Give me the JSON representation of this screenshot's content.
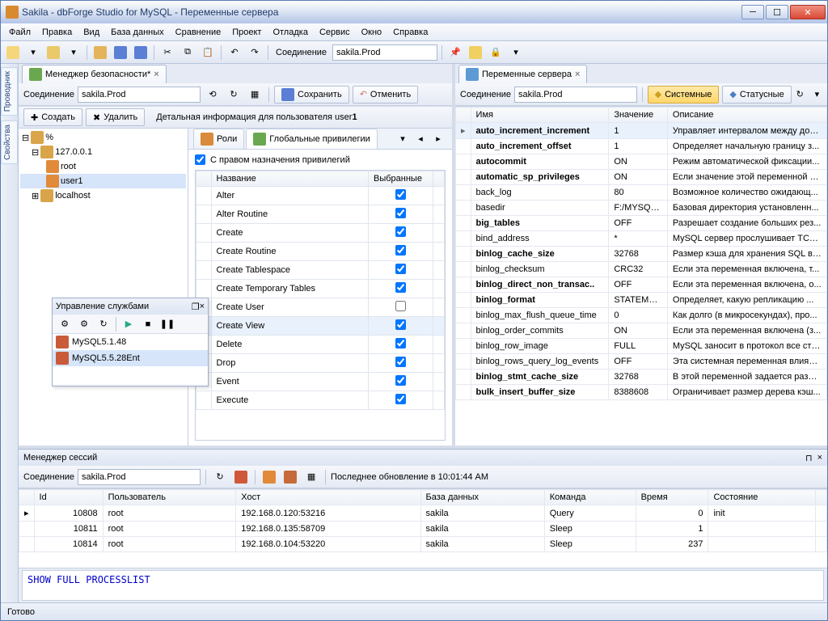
{
  "title": "Sakila - dbForge Studio for MySQL - Переменные сервера",
  "menu": [
    "Файл",
    "Правка",
    "Вид",
    "База данных",
    "Сравнение",
    "Проект",
    "Отладка",
    "Сервис",
    "Окно",
    "Справка"
  ],
  "toolbar": {
    "conn_label": "Соединение",
    "conn_value": "sakila.Prod"
  },
  "side_tabs": [
    "Проводник",
    "Свойства"
  ],
  "sec": {
    "tab": "Менеджер безопасности*",
    "conn_label": "Соединение",
    "conn_value": "sakila.Prod",
    "save": "Сохранить",
    "cancel": "Отменить",
    "create": "Создать",
    "delete": "Удалить",
    "detail_title": "Детальная информация для пользователя user",
    "tabs": {
      "roles": "Роли",
      "global": "Глобальные привилегии"
    },
    "grant_check": "С правом назначения привилегий",
    "cols": {
      "name": "Название",
      "selected": "Выбранные"
    },
    "tree": [
      "%",
      "127.0.0.1",
      "root",
      "user1",
      "localhost"
    ],
    "privs": [
      {
        "n": "Alter",
        "c": true
      },
      {
        "n": "Alter Routine",
        "c": true
      },
      {
        "n": "Create",
        "c": true
      },
      {
        "n": "Create Routine",
        "c": true
      },
      {
        "n": "Create Tablespace",
        "c": true
      },
      {
        "n": "Create Temporary Tables",
        "c": true
      },
      {
        "n": "Create User",
        "c": false
      },
      {
        "n": "Create View",
        "c": true,
        "sel": true
      },
      {
        "n": "Delete",
        "c": true
      },
      {
        "n": "Drop",
        "c": true
      },
      {
        "n": "Event",
        "c": true
      },
      {
        "n": "Execute",
        "c": true
      }
    ]
  },
  "svc": {
    "title": "Управление службами",
    "items": [
      "MySQL5.1.48",
      "MySQL5.5.28Ent"
    ]
  },
  "vars": {
    "tab": "Переменные сервера",
    "conn_label": "Соединение",
    "conn_value": "sakila.Prod",
    "system": "Системные",
    "status": "Статусные",
    "cols": {
      "name": "Имя",
      "value": "Значение",
      "desc": "Описание"
    },
    "rows": [
      {
        "n": "auto_increment_increment",
        "v": "1",
        "d": "Управляет интервалом между доп...",
        "b": 1,
        "sel": 1
      },
      {
        "n": "auto_increment_offset",
        "v": "1",
        "d": "Определяет начальную границу з...",
        "b": 1
      },
      {
        "n": "autocommit",
        "v": "ON",
        "d": "Режим автоматической фиксации...",
        "b": 1
      },
      {
        "n": "automatic_sp_privileges",
        "v": "ON",
        "d": "Если значение этой переменной р...",
        "b": 1
      },
      {
        "n": "back_log",
        "v": "80",
        "d": "Возможное количество ожидающ..."
      },
      {
        "n": "basedir",
        "v": "F:/MYSQL...",
        "d": "Базовая директория установленн..."
      },
      {
        "n": "big_tables",
        "v": "OFF",
        "d": "Разрешает создание больших рез...",
        "b": 1
      },
      {
        "n": "bind_address",
        "v": "*",
        "d": "MySQL сервер прослушивает TCP/..."
      },
      {
        "n": "binlog_cache_size",
        "v": "32768",
        "d": "Размер кэша для хранения SQL вы...",
        "b": 1
      },
      {
        "n": "binlog_checksum",
        "v": "CRC32",
        "d": "Если эта переменная включена, т..."
      },
      {
        "n": "binlog_direct_non_transac..",
        "v": "OFF",
        "d": "Если эта переменная включена, о...",
        "b": 1
      },
      {
        "n": "binlog_format",
        "v": "STATEMENT",
        "d": "Определяет, какую репликацию ...",
        "b": 1
      },
      {
        "n": "binlog_max_flush_queue_time",
        "v": "0",
        "d": "Как долго (в микросекундах), про..."
      },
      {
        "n": "binlog_order_commits",
        "v": "ON",
        "d": "Если эта переменная включена (з..."
      },
      {
        "n": "binlog_row_image",
        "v": "FULL",
        "d": "MySQL заносит в протокол все стр..."
      },
      {
        "n": "binlog_rows_query_log_events",
        "v": "OFF",
        "d": "Эта системная переменная влияет..."
      },
      {
        "n": "binlog_stmt_cache_size",
        "v": "32768",
        "d": "В этой переменной задается разм...",
        "b": 1
      },
      {
        "n": "bulk_insert_buffer_size",
        "v": "8388608",
        "d": "Ограничивает размер дерева кэш...",
        "b": 1
      }
    ]
  },
  "sess": {
    "title": "Менеджер сессий",
    "conn_label": "Соединение",
    "conn_value": "sakila.Prod",
    "updated": "Последнее обновление в 10:01:44 AM",
    "cols": [
      "Id",
      "Пользователь",
      "Хост",
      "База данных",
      "Команда",
      "Время",
      "Состояние"
    ],
    "rows": [
      {
        "id": "10808",
        "u": "root",
        "h": "192.168.0.120:53216",
        "db": "sakila",
        "c": "Query",
        "t": "0",
        "s": "init"
      },
      {
        "id": "10811",
        "u": "root",
        "h": "192.168.0.135:58709",
        "db": "sakila",
        "c": "Sleep",
        "t": "1",
        "s": ""
      },
      {
        "id": "10814",
        "u": "root",
        "h": "192.168.0.104:53220",
        "db": "sakila",
        "c": "Sleep",
        "t": "237",
        "s": ""
      }
    ],
    "sql": "SHOW FULL PROCESSLIST"
  },
  "status": "Готово"
}
